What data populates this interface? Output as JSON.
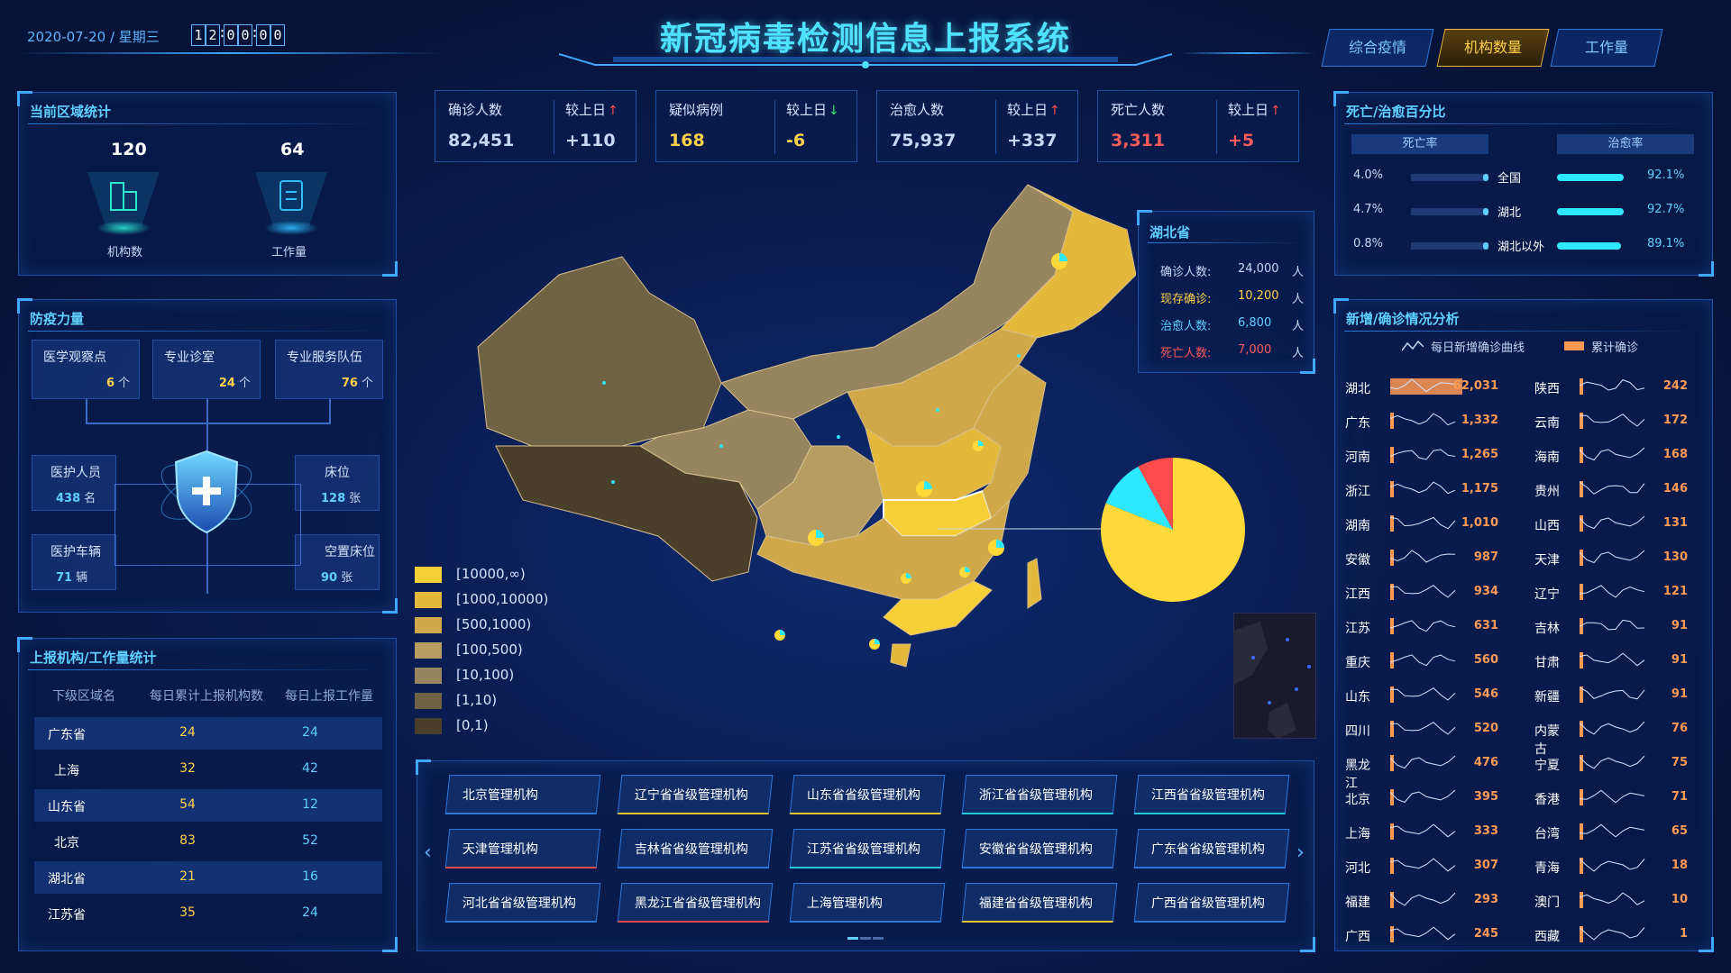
{
  "header": {
    "date": "2020-07-20 / 星期三",
    "clock": [
      "1",
      "2",
      "0",
      "0",
      "0",
      "0"
    ],
    "title": "新冠病毒检测信息上报系统",
    "nav": [
      {
        "label": "综合疫情",
        "active": false
      },
      {
        "label": "机构数量",
        "active": true
      },
      {
        "label": "工作量",
        "active": false
      }
    ]
  },
  "stats": [
    {
      "label": "确诊人数",
      "value": "82,451",
      "cmp_label": "较上日",
      "cmp_value": "+110",
      "direction": "up",
      "value_color": "#c8d8f4",
      "cmp_color": "#c8d8f4"
    },
    {
      "label": "疑似病例",
      "value": "168",
      "cmp_label": "较上日",
      "cmp_value": "-6",
      "direction": "down",
      "value_color": "#ffd24a",
      "cmp_color": "#ffd24a"
    },
    {
      "label": "治愈人数",
      "value": "75,937",
      "cmp_label": "较上日",
      "cmp_value": "+337",
      "direction": "up",
      "value_color": "#c8d8f4",
      "cmp_color": "#c8d8f4"
    },
    {
      "label": "死亡人数",
      "value": "3,311",
      "cmp_label": "较上日",
      "cmp_value": "+5",
      "direction": "up",
      "value_color": "#ff5a5a",
      "cmp_color": "#ff5a5a"
    }
  ],
  "region": {
    "title": "当前区域统计",
    "items": [
      {
        "value": "120",
        "label": "机构数",
        "icon": "building-icon"
      },
      {
        "value": "64",
        "label": "工作量",
        "icon": "clipboard-icon"
      }
    ]
  },
  "force": {
    "title": "防疫力量",
    "top": [
      {
        "label": "医学观察点",
        "value": "6",
        "unit": "个"
      },
      {
        "label": "专业诊室",
        "value": "24",
        "unit": "个"
      },
      {
        "label": "专业服务队伍",
        "value": "76",
        "unit": "个"
      }
    ],
    "left": [
      {
        "label": "医护人员",
        "value": "438",
        "unit": "名"
      },
      {
        "label": "医护车辆",
        "value": "71",
        "unit": "辆"
      }
    ],
    "right": [
      {
        "label": "床位",
        "value": "128",
        "unit": "张"
      },
      {
        "label": "空置床位",
        "value": "90",
        "unit": "张"
      }
    ]
  },
  "table": {
    "title": "上报机构/工作量统计",
    "headers": [
      "下级区域名",
      "每日累计上报机构数",
      "每日上报工作量"
    ],
    "rows": [
      [
        "广东省",
        "24",
        "24"
      ],
      [
        "上海",
        "32",
        "42"
      ],
      [
        "山东省",
        "54",
        "12"
      ],
      [
        "北京",
        "83",
        "52"
      ],
      [
        "湖北省",
        "21",
        "16"
      ],
      [
        "江苏省",
        "35",
        "24"
      ]
    ]
  },
  "legend": [
    {
      "label": "[10000,∞)",
      "color": "#f7d038"
    },
    {
      "label": "[1000,10000)",
      "color": "#e4b83a"
    },
    {
      "label": "[500,1000)",
      "color": "#cfa84a"
    },
    {
      "label": "[100,500)",
      "color": "#b89d62"
    },
    {
      "label": "[10,100)",
      "color": "#978560"
    },
    {
      "label": "[1,10)",
      "color": "#706244"
    },
    {
      "label": "[0,1)",
      "color": "#4a3f2a"
    }
  ],
  "hubei": {
    "title": "湖北省",
    "rows": [
      {
        "label": "确诊人数:",
        "value": "24,000",
        "unit": "人",
        "color": "#c8d8f4"
      },
      {
        "label": "现存确诊:",
        "value": "10,200",
        "unit": "人",
        "color": "#ffd24a"
      },
      {
        "label": "治愈人数:",
        "value": "6,800",
        "unit": "人",
        "color": "#5fd0ff"
      },
      {
        "label": "死亡人数:",
        "value": "7,000",
        "unit": "人",
        "color": "#ff5a5a"
      }
    ]
  },
  "pie": {
    "slices": [
      {
        "value": 81,
        "color": "#ffd93a"
      },
      {
        "value": 11,
        "color": "#2ee8ff"
      },
      {
        "value": 8,
        "color": "#ff4b4b"
      }
    ]
  },
  "orgs": [
    [
      {
        "label": "北京管理机构",
        "accent": "#2e76d6"
      },
      {
        "label": "辽宁省省级管理机构",
        "accent": "#e8c02a"
      },
      {
        "label": "山东省省级管理机构",
        "accent": "#e8c02a"
      },
      {
        "label": "浙江省省级管理机构",
        "accent": "#22c8d8"
      },
      {
        "label": "江西省省级管理机构",
        "accent": "#22c8d8"
      }
    ],
    [
      {
        "label": "天津管理机构",
        "accent": "#e84848"
      },
      {
        "label": "吉林省省级管理机构",
        "accent": "#2e76d6"
      },
      {
        "label": "江苏省省级管理机构",
        "accent": "#22c8d8"
      },
      {
        "label": "安徽省省级管理机构",
        "accent": "#2e76d6"
      },
      {
        "label": "广东省省级管理机构",
        "accent": "#2e76d6"
      }
    ],
    [
      {
        "label": "河北省省级管理机构",
        "accent": "#2e76d6"
      },
      {
        "label": "黑龙江省省级管理机构",
        "accent": "#e84848"
      },
      {
        "label": "上海管理机构",
        "accent": "#2e76d6"
      },
      {
        "label": "福建省省级管理机构",
        "accent": "#e8c02a"
      },
      {
        "label": "广西省省级管理机构",
        "accent": "#2e76d6"
      }
    ]
  ],
  "ratio": {
    "title": "死亡/治愈百分比",
    "col_left": "死亡率",
    "col_right": "治愈率",
    "rows": [
      {
        "name": "全国",
        "death": "4.0%",
        "cure": "92.1%",
        "death_v": 4.0,
        "cure_v": 92.1
      },
      {
        "name": "湖北",
        "death": "4.7%",
        "cure": "92.7%",
        "death_v": 4.7,
        "cure_v": 92.7
      },
      {
        "name": "湖北以外",
        "death": "0.8%",
        "cure": "89.1%",
        "death_v": 0.8,
        "cure_v": 89.1
      }
    ]
  },
  "analysis": {
    "title": "新增/确诊情况分析",
    "legend_line": "每日新增确诊曲线",
    "legend_bar": "累计确诊",
    "left": [
      [
        "湖北",
        "62,031"
      ],
      [
        "广东",
        "1,332"
      ],
      [
        "河南",
        "1,265"
      ],
      [
        "浙江",
        "1,175"
      ],
      [
        "湖南",
        "1,010"
      ],
      [
        "安徽",
        "987"
      ],
      [
        "江西",
        "934"
      ],
      [
        "江苏",
        "631"
      ],
      [
        "重庆",
        "560"
      ],
      [
        "山东",
        "546"
      ],
      [
        "四川",
        "520"
      ],
      [
        "黑龙江",
        "476"
      ],
      [
        "北京",
        "395"
      ],
      [
        "上海",
        "333"
      ],
      [
        "河北",
        "307"
      ],
      [
        "福建",
        "293"
      ],
      [
        "广西",
        "245"
      ]
    ],
    "right": [
      [
        "陕西",
        "242"
      ],
      [
        "云南",
        "172"
      ],
      [
        "海南",
        "168"
      ],
      [
        "贵州",
        "146"
      ],
      [
        "山西",
        "131"
      ],
      [
        "天津",
        "130"
      ],
      [
        "辽宁",
        "121"
      ],
      [
        "吉林",
        "91"
      ],
      [
        "甘肃",
        "91"
      ],
      [
        "新疆",
        "91"
      ],
      [
        "内蒙古",
        "76"
      ],
      [
        "宁夏",
        "75"
      ],
      [
        "香港",
        "71"
      ],
      [
        "台湾",
        "65"
      ],
      [
        "青海",
        "18"
      ],
      [
        "澳门",
        "10"
      ],
      [
        "西藏",
        "1"
      ]
    ]
  }
}
